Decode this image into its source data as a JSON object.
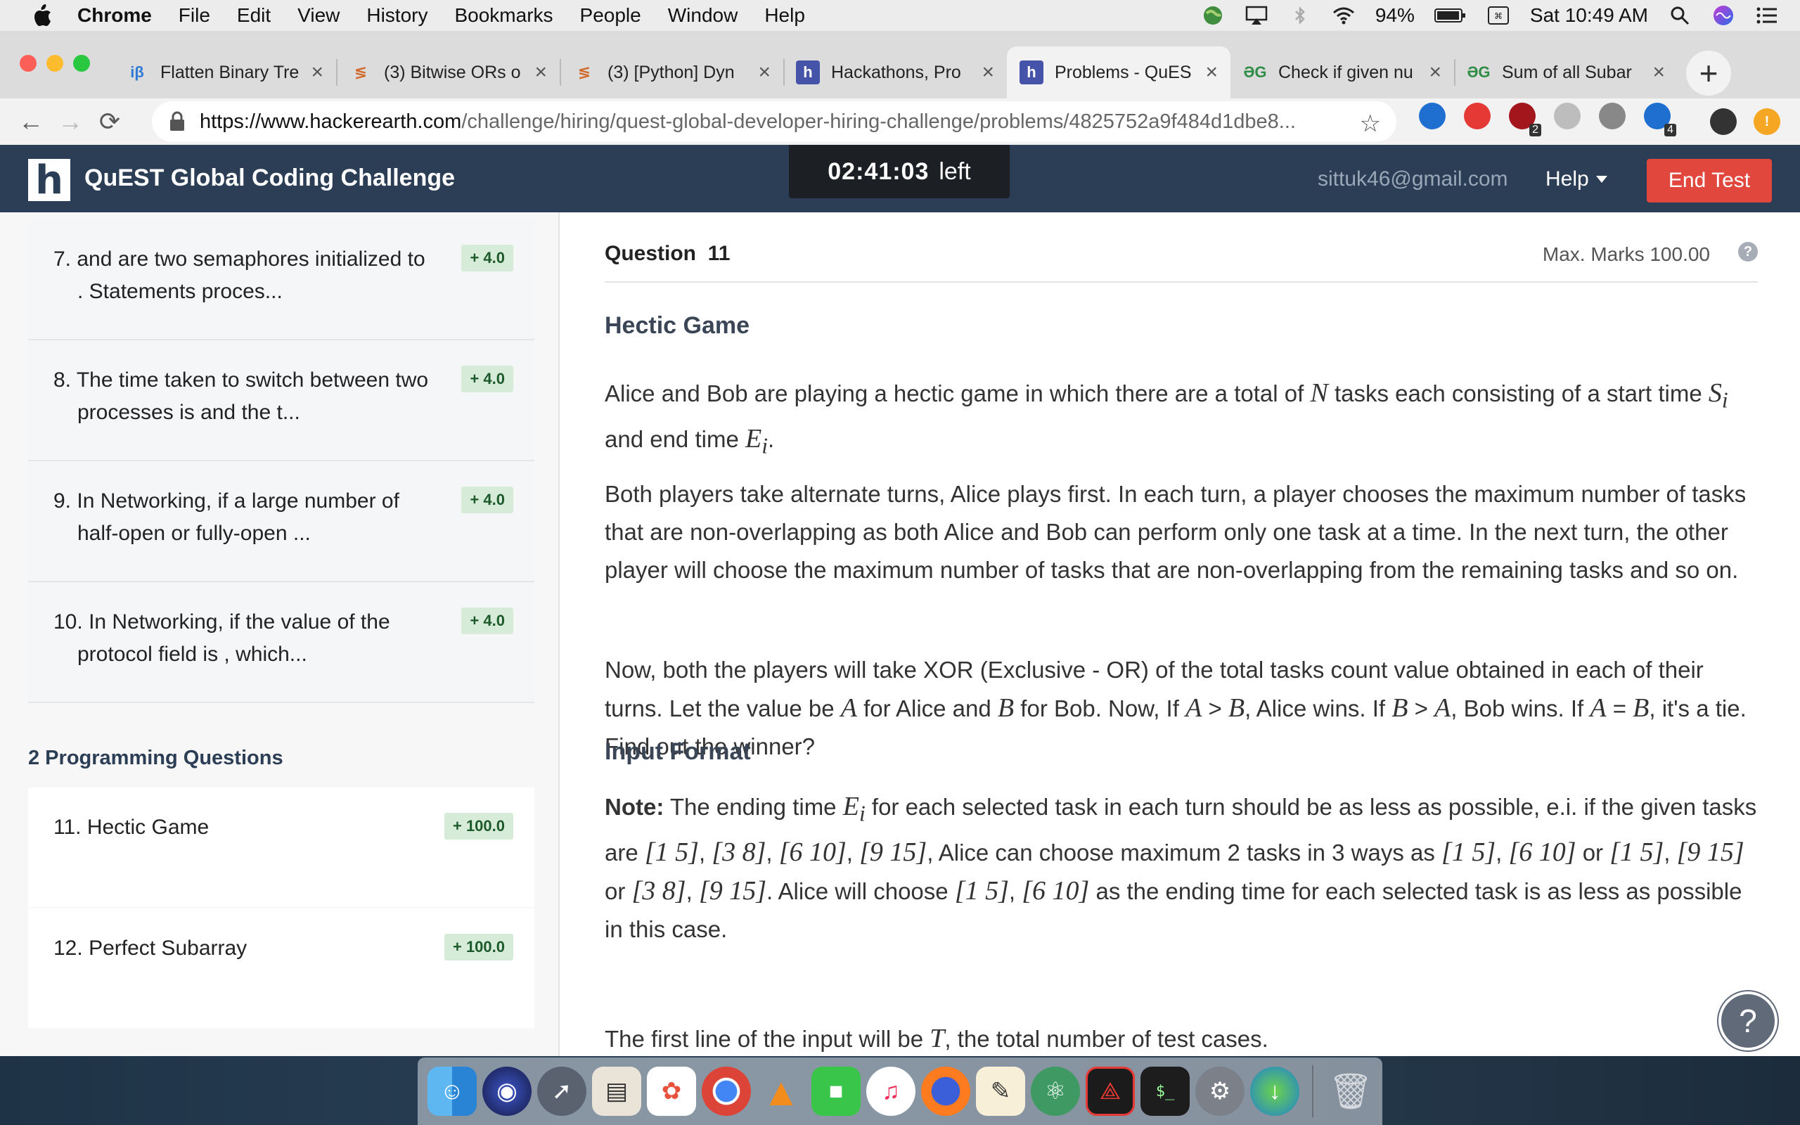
{
  "menubar": {
    "app": "Chrome",
    "items": [
      "File",
      "Edit",
      "View",
      "History",
      "Bookmarks",
      "People",
      "Window",
      "Help"
    ],
    "battery": "94%",
    "clock": "Sat 10:49 AM"
  },
  "tabs": [
    {
      "icon": "iβ",
      "title": "Flatten Binary Tre",
      "active": false
    },
    {
      "icon": "≶",
      "title": "(3) Bitwise ORs o",
      "active": false
    },
    {
      "icon": "≶",
      "title": "(3) [Python] Dyn",
      "active": false
    },
    {
      "icon": "h",
      "title": "Hackathons, Pro",
      "active": false
    },
    {
      "icon": "h",
      "title": "Problems - QuES",
      "active": true
    },
    {
      "icon": "ƏG",
      "title": "Check if given nu",
      "active": false
    },
    {
      "icon": "ƏG",
      "title": "Sum of all Subar",
      "active": false
    }
  ],
  "omnibox": {
    "host": "https://www.hackerearth.com",
    "path": "/challenge/hiring/quest-global-developer-hiring-challenge/problems/4825752a9f484d1dbe8..."
  },
  "extensions": [
    {
      "name": "diamond-ext-icon",
      "badge": ""
    },
    {
      "name": "red-flag-ext-icon",
      "badge": ""
    },
    {
      "name": "ublock-ext-icon",
      "badge": "2"
    },
    {
      "name": "ext-icon-grey",
      "badge": ""
    },
    {
      "name": "ext-icon-dark",
      "badge": ""
    },
    {
      "name": "ext-icon-blue",
      "badge": "4"
    }
  ],
  "header": {
    "logo": "h",
    "title": "QuEST Global Coding Challenge",
    "timer": "02:41:03",
    "timer_suffix": "left",
    "email": "sittuk46@gmail.com",
    "help": "Help",
    "end_test": "End Test"
  },
  "sidebar": {
    "mcq": [
      {
        "num": "7.",
        "text": "and are two semaphores initialized to . Statements proces...",
        "score": "+ 4.0"
      },
      {
        "num": "8.",
        "text": "The time taken to switch between two processes is and the t...",
        "score": "+ 4.0"
      },
      {
        "num": "9.",
        "text": "In Networking, if a large number of half-open or fully-open ...",
        "score": "+ 4.0"
      },
      {
        "num": "10.",
        "text": "In Networking, if the value of the protocol field is , which...",
        "score": "+ 4.0"
      }
    ],
    "section_title": "2 Programming Questions",
    "programming": [
      {
        "num": "11.",
        "text": "Hectic Game",
        "score": "+ 100.0"
      },
      {
        "num": "12.",
        "text": "Perfect Subarray",
        "score": "+ 100.0"
      }
    ]
  },
  "question": {
    "label": "Question  11",
    "marks": "Max. Marks 100.00",
    "title": "Hectic Game",
    "input_format_heading": "Input Format",
    "input_line_1": "The first line of the input will be T, the total number of test cases."
  }
}
